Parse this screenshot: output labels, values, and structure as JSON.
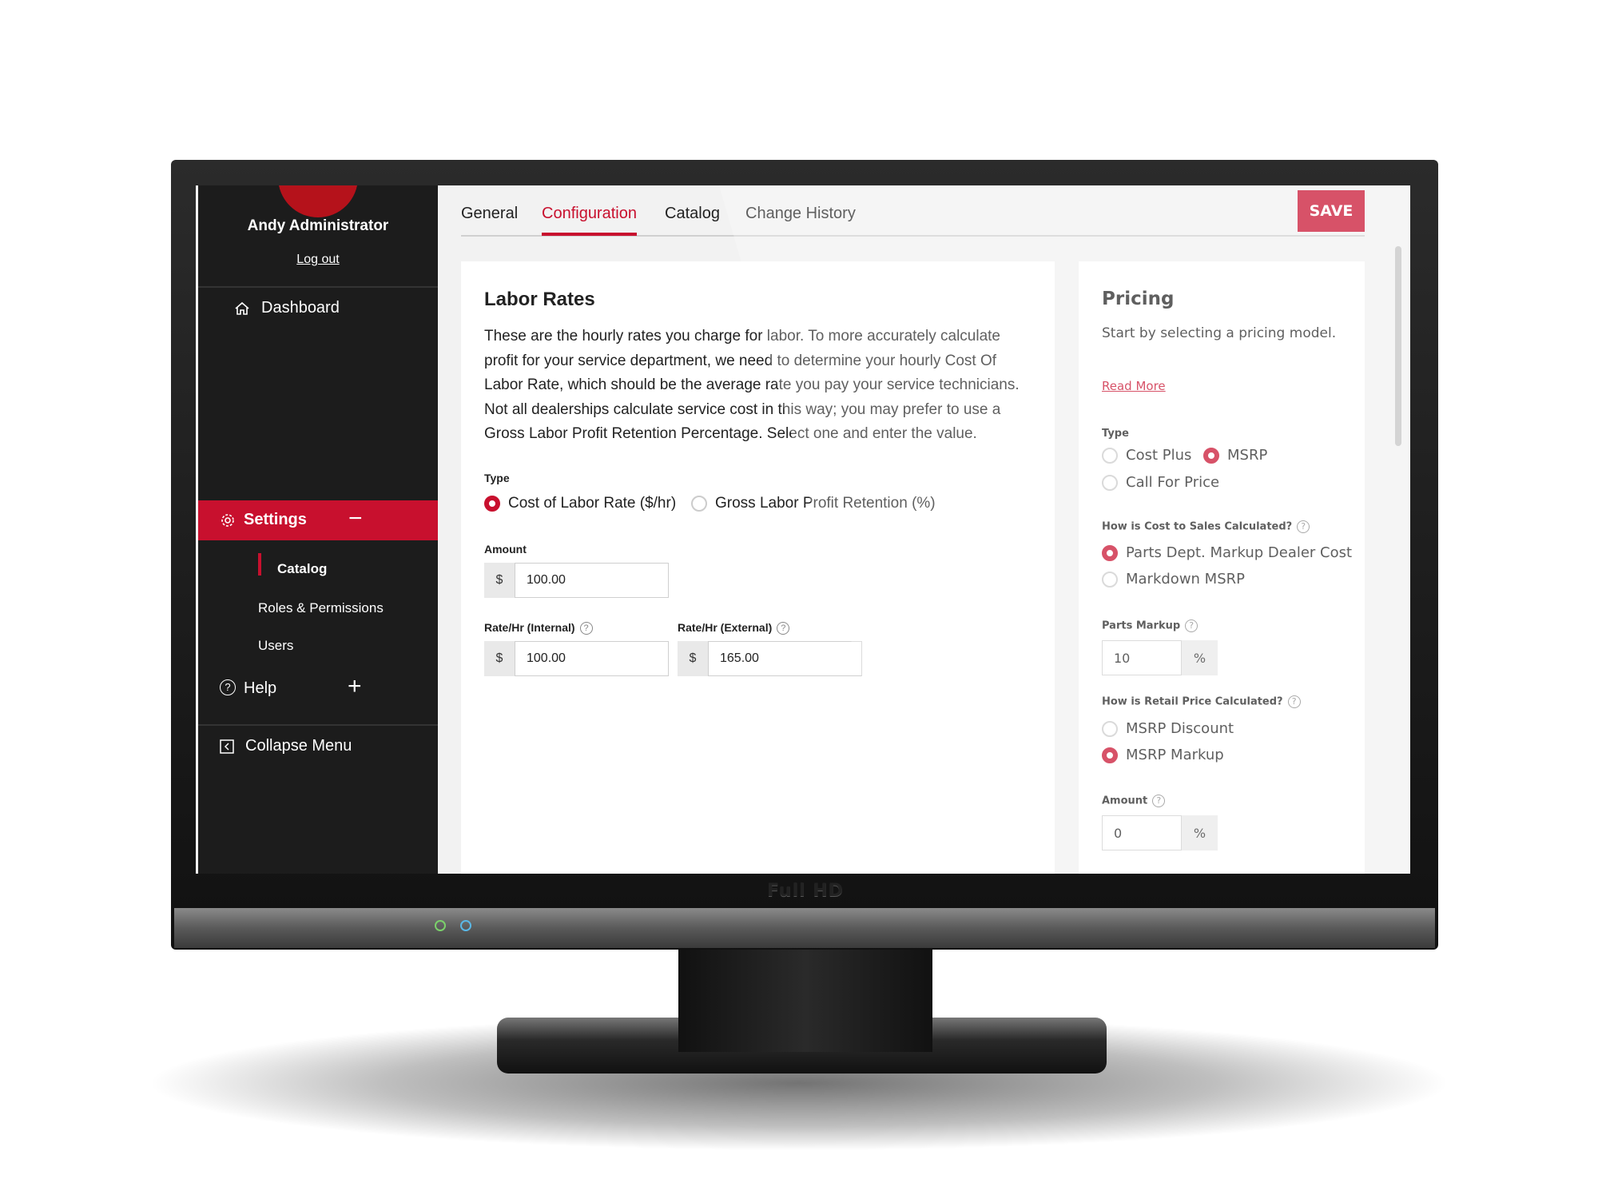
{
  "monitor": {
    "brand_label": "Full HD"
  },
  "user": {
    "name": "Andy Administrator",
    "logout": "Log out"
  },
  "sidebar": {
    "dashboard": "Dashboard",
    "settings": "Settings",
    "settings_toggle": "−",
    "sub": [
      "Catalog",
      "Roles & Permissions",
      "Users"
    ],
    "help": "Help",
    "help_toggle": "+",
    "collapse": "Collapse Menu"
  },
  "tabs": [
    "General",
    "Configuration",
    "Catalog",
    "Change History"
  ],
  "active_tab": "Configuration",
  "save_label": "SAVE",
  "labor": {
    "title": "Labor Rates",
    "description": "These are the hourly rates you charge for labor. To more accurately calculate profit for your service department, we need to determine your hourly Cost Of Labor Rate, which should be the average rate you pay your service technicians. Not all dealerships calculate service cost in this way; you may prefer to use a Gross Labor Profit Retention Percentage. Select one and enter the value.",
    "type_label": "Type",
    "type_options": [
      "Cost of Labor Rate ($/hr)",
      "Gross Labor Profit Retention (%)"
    ],
    "type_selected": "Cost of Labor Rate ($/hr)",
    "amount_label": "Amount",
    "currency": "$",
    "amount": "100.00",
    "internal_label": "Rate/Hr (Internal)",
    "internal": "100.00",
    "external_label": "Rate/Hr (External)",
    "external": "165.00"
  },
  "pricing": {
    "title": "Pricing",
    "subtitle": "Start by selecting a pricing model.",
    "read_more": "Read More",
    "type_label": "Type",
    "type_options": [
      "Cost Plus",
      "MSRP",
      "Call For Price"
    ],
    "type_selected": "MSRP",
    "cost_label": "How is Cost to Sales Calculated?",
    "cost_options": [
      "Parts Dept. Markup Dealer Cost",
      "Markdown MSRP"
    ],
    "cost_selected": "Parts Dept. Markup Dealer Cost",
    "markup_label": "Parts Markup",
    "markup": "10",
    "percent": "%",
    "retail_label": "How is Retail Price Calculated?",
    "retail_options": [
      "MSRP Discount",
      "MSRP Markup"
    ],
    "retail_selected": "MSRP Markup",
    "amount_label": "Amount",
    "amount": "0"
  },
  "colors": {
    "accent": "#c8102e",
    "sidebar": "#1c1c1c"
  }
}
